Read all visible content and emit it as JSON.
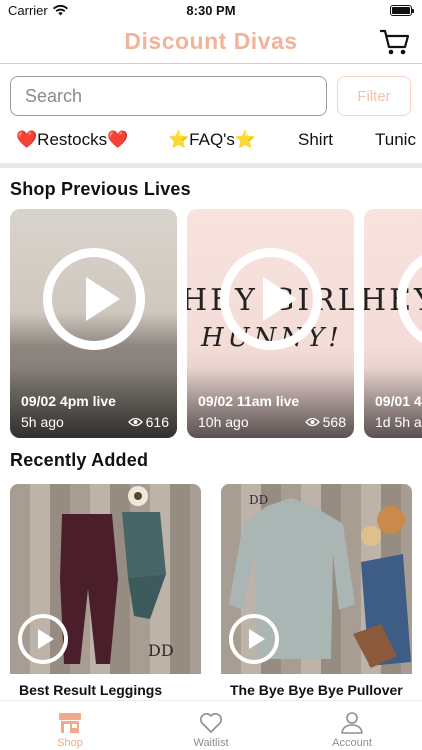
{
  "status_bar": {
    "carrier": "Carrier",
    "time": "8:30 PM"
  },
  "header": {
    "title": "Discount Divas",
    "cart_icon": "cart-icon"
  },
  "search": {
    "placeholder": "Search",
    "filter_label": "Filter"
  },
  "categories": [
    "❤️Restocks❤️",
    "⭐FAQ's⭐",
    "Shirt",
    "Tunic"
  ],
  "sections": {
    "lives_title": "Shop Previous Lives",
    "recent_title": "Recently Added"
  },
  "lives": [
    {
      "label": "09/02 4pm live",
      "ago": "5h ago",
      "views": "616"
    },
    {
      "label": "09/02 11am live",
      "ago": "10h ago",
      "views": "568",
      "banner_line1": "HEY GIRL",
      "banner_line2": "HUNNY!"
    },
    {
      "label": "09/01 4",
      "ago": "1d 5h a",
      "banner_line1": "HEY GIRL"
    }
  ],
  "products": [
    {
      "name": "Best Result Leggings"
    },
    {
      "name": "The Bye Bye Bye Pullover"
    }
  ],
  "tabbar": {
    "items": [
      "Shop",
      "Waitlist",
      "Account"
    ],
    "active": "Shop"
  },
  "colors": {
    "brand": "#f2b39a",
    "active_tab": "#f2a98c",
    "inactive_tab": "#8e8e93"
  }
}
